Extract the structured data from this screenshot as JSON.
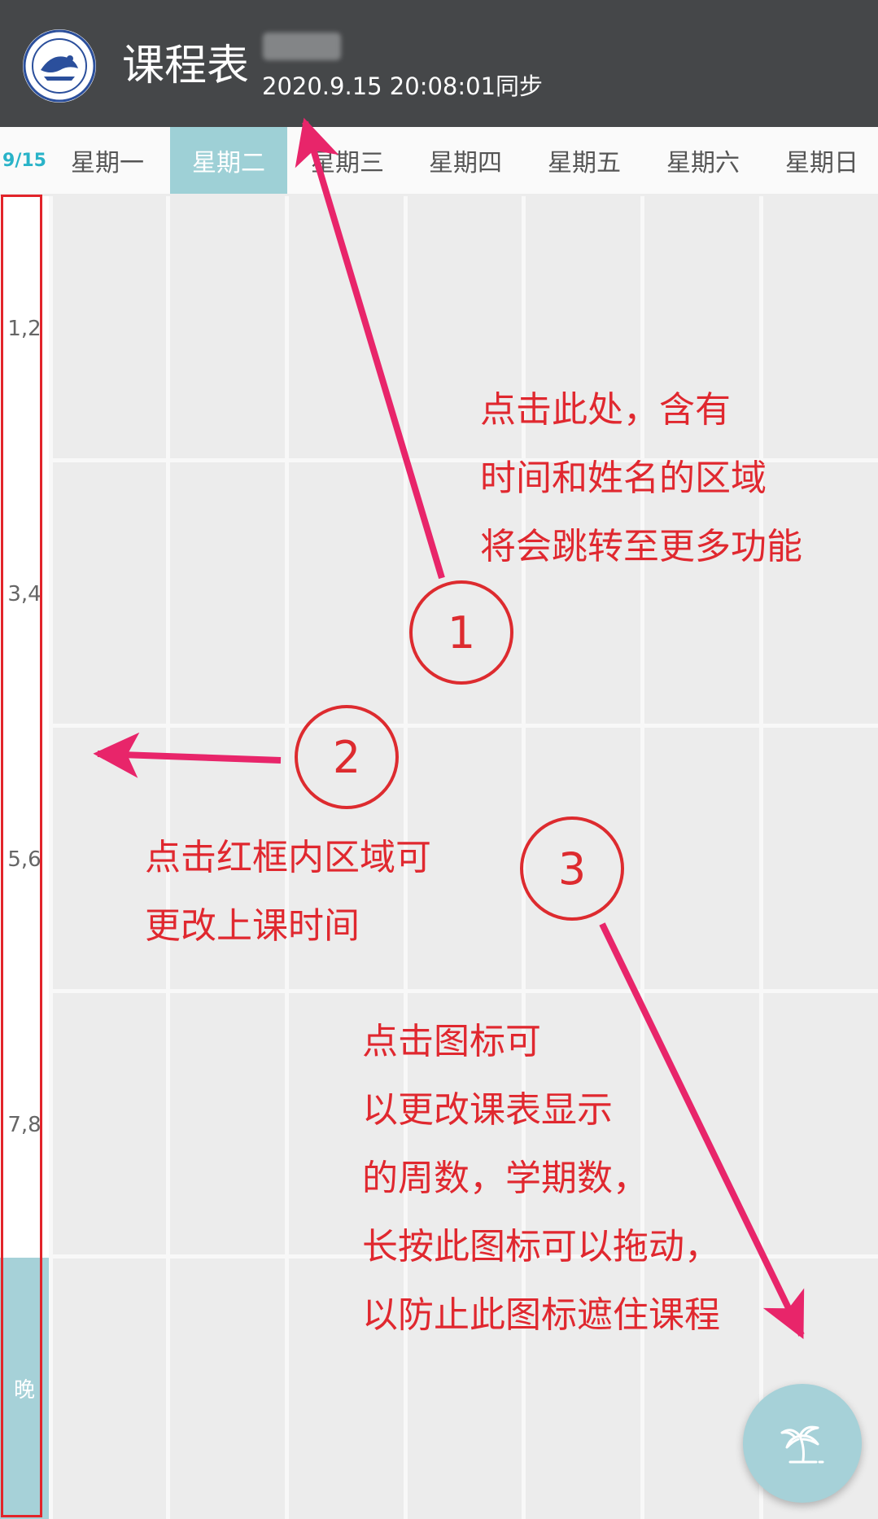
{
  "header": {
    "title": "课程表",
    "sync_text": "2020.9.15 20:08:01同步"
  },
  "days": {
    "date": "9/15",
    "labels": [
      "星期一",
      "星期二",
      "星期三",
      "星期四",
      "星期五",
      "星期六",
      "星期日"
    ],
    "active_day": "星期二"
  },
  "periods": [
    "1,2",
    "3,4",
    "5,6",
    "7,8",
    "晚"
  ],
  "annotations": {
    "note1_lines": [
      "点击此处，含有",
      "时间和姓名的区域",
      "将会跳转至更多功能"
    ],
    "note2_lines": [
      "点击红框内区域可",
      "更改上课时间"
    ],
    "note3_lines": [
      "点击图标可",
      "以更改课表显示",
      "的周数，学期数，",
      "长按此图标可以拖动，",
      "以防止此图标遮住课程"
    ],
    "circle1": "1",
    "circle2": "2",
    "circle3": "3"
  },
  "fab": {
    "icon": "palm-tree-icon"
  },
  "colors": {
    "header_bg": "#454749",
    "accent_teal": "#a6d1d8",
    "date_color": "#29b3c8",
    "annotation_red": "#e0282f",
    "arrow_pink": "#e8256a"
  }
}
